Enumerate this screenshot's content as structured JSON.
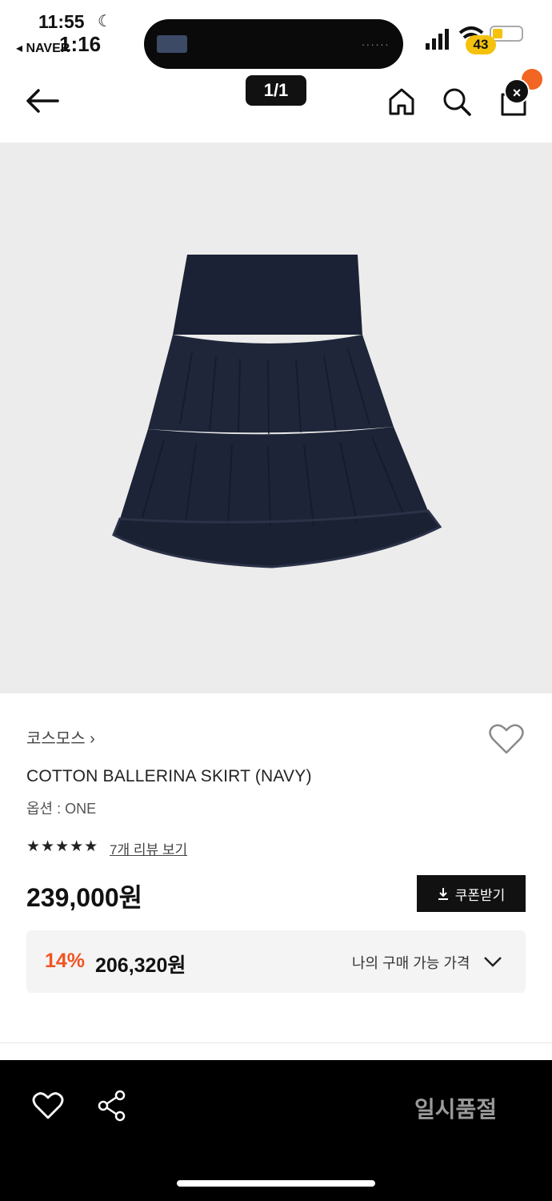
{
  "status_bar": {
    "time": "11:55",
    "back_app": "◂ NAVER",
    "time_overlay": "1:16",
    "battery_level": "43",
    "island_dots": "......"
  },
  "header": {
    "pager": "1/1",
    "close_glyph": "×",
    "icons": [
      "back-arrow-icon",
      "home-icon",
      "search-icon",
      "shopping-bag-icon"
    ]
  },
  "product": {
    "brand": "코스모스 ›",
    "name": "COTTON BALLERINA SKIRT (NAVY)",
    "option": "옵션 : ONE",
    "rating_stars": "★★★★★",
    "rating_value": 5,
    "review_link": "7개 리뷰 보기",
    "price": "239,000원",
    "coupon_label": "쿠폰받기",
    "discount_pct": "14%",
    "discount_price": "206,320원",
    "my_price_label": "나의 구매 가능 가격"
  },
  "bottom_bar": {
    "soldout_label": "일시품절"
  },
  "colors": {
    "accent": "#f05423",
    "image_bg": "#ececec",
    "skirt": "#1c2235"
  }
}
